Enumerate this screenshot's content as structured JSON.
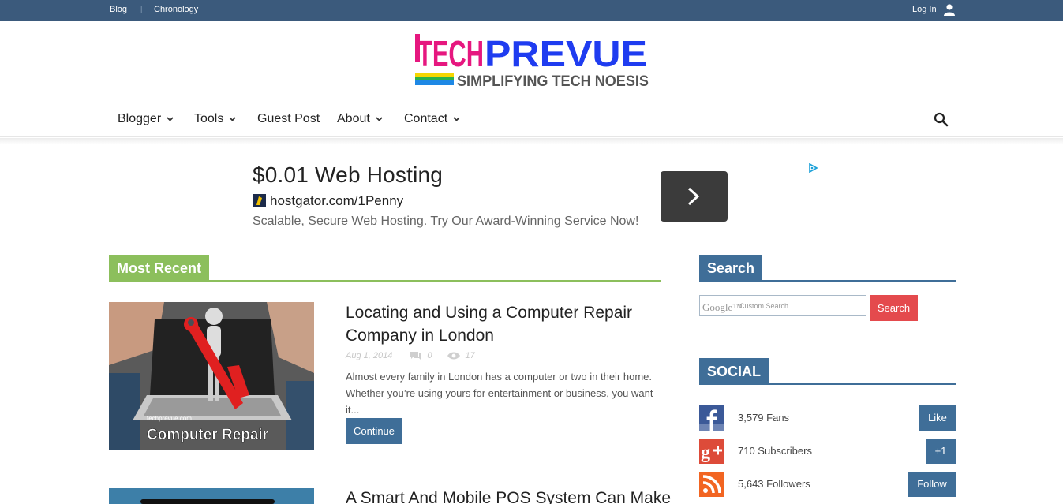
{
  "topbar": {
    "blog": "Blog",
    "chronology": "Chronology",
    "login": "Log In"
  },
  "logo": {
    "word_tech": "TECH",
    "word_prevue": "PREVUE",
    "tagline": "SIMPLIFYING TECH NOESIS"
  },
  "nav": {
    "items": [
      {
        "label": "Blogger",
        "dropdown": true
      },
      {
        "label": "Tools",
        "dropdown": true
      },
      {
        "label": "Guest Post",
        "dropdown": false
      },
      {
        "label": "About",
        "dropdown": true
      },
      {
        "label": "Contact",
        "dropdown": true
      }
    ]
  },
  "ad": {
    "title": "$0.01 Web Hosting",
    "url": "hostgator.com/1Penny",
    "description": "Scalable, Secure Web Hosting. Try Our Award-Winning Service Now!"
  },
  "main": {
    "section_title": "Most Recent",
    "posts": [
      {
        "title": "Locating and Using a Computer Repair Company in London",
        "date": "Aug 1, 2014",
        "comments": "0",
        "views": "17",
        "excerpt": "Almost every family in London has a computer or two in their home. Whether you’re using yours for entertainment or business, you want it...",
        "continue_label": "Continue",
        "thumb_site": "techprevue.com",
        "thumb_caption": "Computer Repair"
      },
      {
        "title": "A Smart And Mobile POS System Can Make"
      }
    ]
  },
  "sidebar": {
    "search_title": "Search",
    "search_placeholder_brand": "Google™",
    "search_placeholder": "Custom Search",
    "search_button": "Search",
    "social_title": "SOCIAL",
    "social": [
      {
        "network": "facebook",
        "count": "3,579 Fans",
        "action": "Like"
      },
      {
        "network": "google-plus",
        "count": "710 Subscribers",
        "action": "+1"
      },
      {
        "network": "rss",
        "count": "5,643 Followers",
        "action": "Follow"
      }
    ]
  },
  "colors": {
    "topbar": "#3b5a7c",
    "most_recent": "#8cbf5c",
    "sidebar_header": "#3f6e98",
    "search_button": "#e44a4d",
    "facebook": "#3b5998",
    "google_plus": "#dd4b39",
    "rss": "#f26522"
  }
}
